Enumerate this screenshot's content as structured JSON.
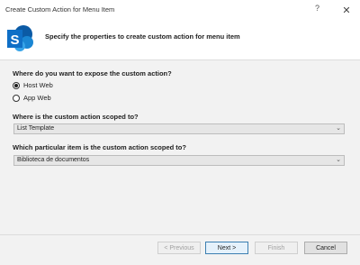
{
  "window": {
    "title": "Create Custom Action for Menu Item",
    "help_glyph": "?",
    "close_glyph": "✕"
  },
  "banner": {
    "icon": "sharepoint-logo-icon",
    "logo_letter": "S",
    "heading": "Specify the properties to create custom action for menu item"
  },
  "expose": {
    "question": "Where do you want to expose the custom action?",
    "options": [
      {
        "label": "Host Web",
        "selected": true
      },
      {
        "label": "App Web",
        "selected": false
      }
    ]
  },
  "scope": {
    "question": "Where is the custom action scoped to?",
    "value": "List Template"
  },
  "item": {
    "question": "Which particular item is the custom action scoped to?",
    "value": "Biblioteca de documentos"
  },
  "footer": {
    "previous": "< Previous",
    "next": "Next >",
    "finish": "Finish",
    "cancel": "Cancel"
  },
  "colors": {
    "sharepoint_blue": "#0f6fc6",
    "body_bg": "#f2f2f2"
  }
}
